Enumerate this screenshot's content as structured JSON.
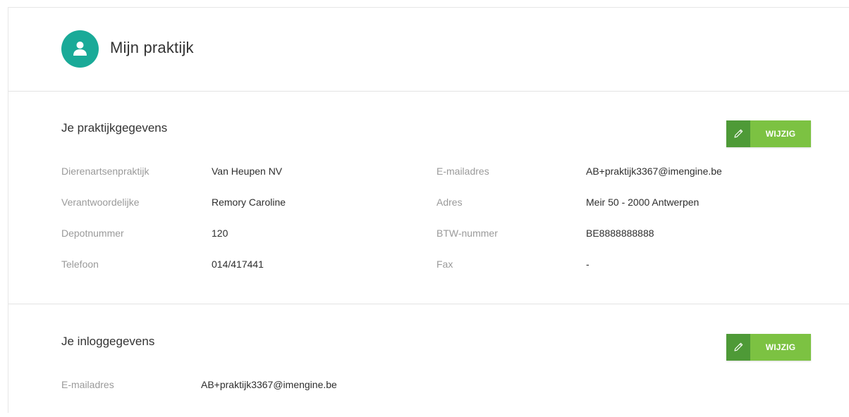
{
  "header": {
    "title": "Mijn praktijk",
    "avatar_icon": "user-icon",
    "accent_color": "#1aaa98"
  },
  "practice": {
    "title": "Je praktijkgegevens",
    "edit_label": "WIJZIG",
    "left_fields": [
      {
        "label": "Dierenartsenpraktijk",
        "value": "Van Heupen NV"
      },
      {
        "label": "Verantwoordelijke",
        "value": "Remory Caroline"
      },
      {
        "label": "Depotnummer",
        "value": "120"
      },
      {
        "label": "Telefoon",
        "value": "014/417441"
      }
    ],
    "right_fields": [
      {
        "label": "E-mailadres",
        "value": "AB+praktijk3367@imengine.be"
      },
      {
        "label": "Adres",
        "value": "Meir 50 - 2000 Antwerpen"
      },
      {
        "label": "BTW-nummer",
        "value": "BE8888888888"
      },
      {
        "label": "Fax",
        "value": "-"
      }
    ]
  },
  "login": {
    "title": "Je inloggegevens",
    "edit_label": "WIJZIG",
    "fields": [
      {
        "label": "E-mailadres",
        "value": "AB+praktijk3367@imengine.be"
      }
    ]
  },
  "colors": {
    "button_dark": "#4e9a37",
    "button_light": "#7cc242"
  }
}
